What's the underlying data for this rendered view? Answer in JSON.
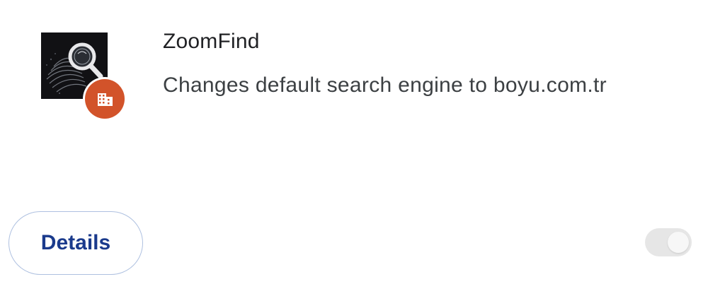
{
  "extension": {
    "name": "ZoomFind",
    "description": "Changes default search engine to boyu.com.tr",
    "icon": "magnifier-fingerprint-icon",
    "policy_badge_icon": "enterprise-building-icon",
    "policy_badge_color": "#d2532a"
  },
  "actions": {
    "details_label": "Details"
  },
  "toggle": {
    "state": "on",
    "disabled": true
  },
  "colors": {
    "details_text": "#1a3a8c",
    "details_border": "#aec0e0",
    "toggle_track": "#e6e6e6"
  }
}
